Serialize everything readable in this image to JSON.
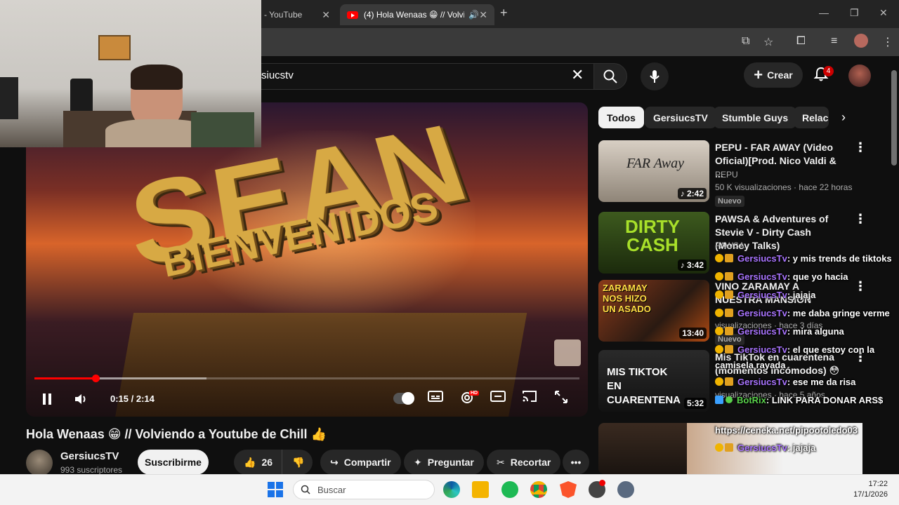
{
  "browser": {
    "tabs": [
      {
        "title": "anal - YouTube",
        "active": false
      },
      {
        "title": "(4) Hola Wenaas 😁 // Volvi",
        "active": true
      }
    ]
  },
  "header": {
    "search_value": "siucstv",
    "create_label": "Crear",
    "notifications_count": "4"
  },
  "player": {
    "overlay_line1": "SEAN",
    "overlay_line2": "BIENVENIDOS",
    "current_time": "0:15",
    "duration": "2:14",
    "time_display": "0:15 / 2:14",
    "progress_fraction": 0.112,
    "buffered_fraction": 0.316,
    "hd_badge": "HD",
    "watermark": "GersiucsTV"
  },
  "video": {
    "title": "Hola Wenaas 😁 // Volviendo a Youtube de Chill 👍",
    "channel": "GersiucsTV",
    "subscribers": "993 suscriptores",
    "subscribe_label": "Suscribirme",
    "likes": "26",
    "share_label": "Compartir",
    "ask_label": "Preguntar",
    "clip_label": "Recortar"
  },
  "chips": [
    "Todos",
    "GersiucsTV",
    "Stumble Guys",
    "Relaci"
  ],
  "recommendations": [
    {
      "title": "PEPU - FAR AWAY (Video Oficial)[Prod. Nico Valdi & ...",
      "channel": "PEPU",
      "meta": "50 K visualizaciones · hace 22 horas",
      "badge": "Nuevo",
      "duration": "2:42",
      "thumb_text": "FAR Away"
    },
    {
      "title": "PAWSA & Adventures of Stevie V - Dirty Cash (Money Talks)",
      "channel": "PAWSA",
      "meta": "",
      "badge": "",
      "duration": "3:42",
      "thumb_text": "DIRTY CASH"
    },
    {
      "title": "VINO ZARAMAY A NUESTRA MANSION",
      "channel": "",
      "meta": "visualizaciones · hace 3 días",
      "badge": "Nuevo",
      "duration": "13:40",
      "thumb_text": "ZARAMAY NOS HIZO UN ASADO"
    },
    {
      "title": "Mis TikTok en cuarentena (momentos incómodos) 😳",
      "channel": "",
      "meta": "visualizaciones · hace 5 años",
      "badge": "",
      "duration": "5:32",
      "thumb_text": "MIS TIKTOK EN CUARENTENA"
    }
  ],
  "chat": [
    {
      "user": "GersiucsTv",
      "msg": ": y mis trends de tiktoks"
    },
    {
      "user": "GersiucsTv",
      "msg": ": que yo hacia"
    },
    {
      "user": "GersiucsTv",
      "msg": ": jajaja"
    },
    {
      "user": "GersiucsTv",
      "msg": ": me daba gringe verme"
    },
    {
      "user": "GersiucsTv",
      "msg": ": mira alguna"
    },
    {
      "user": "GersiucsTv",
      "msg": ": el que estoy con la"
    },
    {
      "user": "",
      "msg": "camisela rayada"
    },
    {
      "user": "GersiucsTv",
      "msg": ": ese me da risa"
    },
    {
      "user": "BotRix",
      "msg": ": LINK PARA DONAR ARS$"
    },
    {
      "user": "",
      "msg": "https://ceneka.net/pipootoledo03"
    },
    {
      "user": "GersiucsTv",
      "msg": ": jajaja"
    }
  ],
  "taskbar": {
    "search_placeholder": "Buscar",
    "time": "17:22",
    "date": "17/1/2026"
  },
  "colors": {
    "accent": "#ff0000",
    "chat_user": "#a974ff",
    "bot_user": "#59d14b"
  }
}
